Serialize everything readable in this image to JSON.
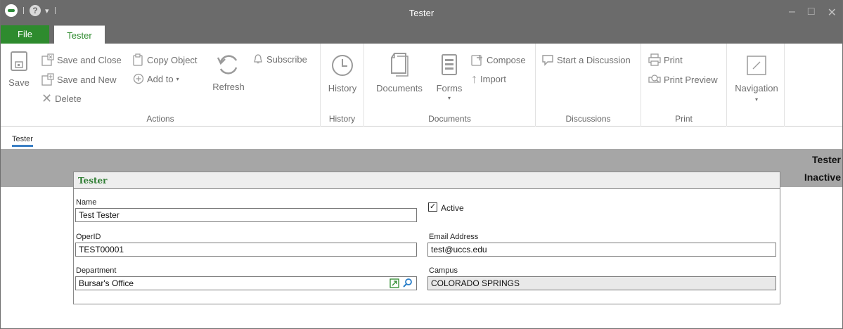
{
  "window": {
    "title": "Tester"
  },
  "tabs": {
    "file": "File",
    "tester": "Tester"
  },
  "ribbon": {
    "actions": {
      "save": "Save",
      "save_and_close": "Save and Close",
      "save_and_new": "Save and New",
      "delete": "Delete",
      "copy_object": "Copy Object",
      "add_to": "Add to",
      "refresh": "Refresh",
      "subscribe": "Subscribe",
      "group_label": "Actions"
    },
    "history": {
      "history": "History",
      "group_label": "History"
    },
    "documents": {
      "documents": "Documents",
      "forms": "Forms",
      "compose": "Compose",
      "import": "Import",
      "group_label": "Documents"
    },
    "discussions": {
      "start": "Start a Discussion",
      "group_label": "Discussions"
    },
    "print": {
      "print": "Print",
      "print_preview": "Print Preview",
      "group_label": "Print"
    },
    "navigation": {
      "label": "Navigation"
    }
  },
  "breadcrumb": "Tester",
  "header": {
    "name": "Tester",
    "status": "Inactive"
  },
  "form": {
    "title": "Tester",
    "name": {
      "label": "Name",
      "value": "Test Tester"
    },
    "active": {
      "label": "Active",
      "checked": true
    },
    "operid": {
      "label": "OperID",
      "value": "TEST00001"
    },
    "email": {
      "label": "Email Address",
      "value": "test@uccs.edu"
    },
    "department": {
      "label": "Department",
      "value": "Bursar's Office"
    },
    "campus": {
      "label": "Campus",
      "value": "COLORADO SPRINGS"
    }
  },
  "colors": {
    "accent_green": "#2e8b2e",
    "titlebar_gray": "#6b6b6b",
    "band_gray": "#a6a6a6",
    "link_blue": "#3b7fc4"
  }
}
